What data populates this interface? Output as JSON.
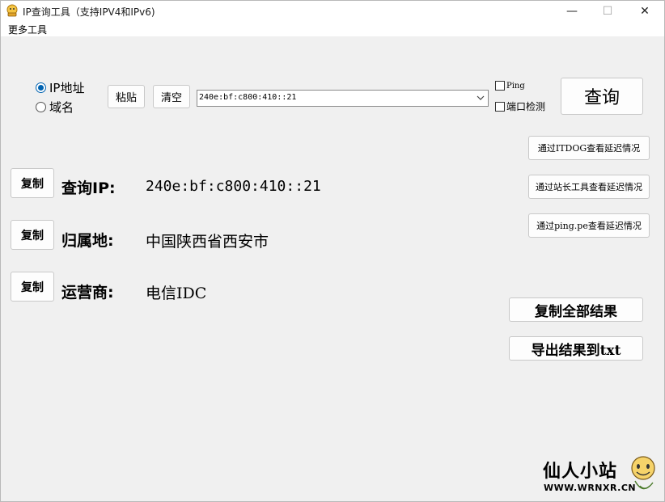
{
  "window": {
    "title": "IP查询工具（支持IPV4和IPv6)",
    "controls": {
      "minimize": "—",
      "maximize": "☐",
      "close": "✕"
    }
  },
  "menu": {
    "more_tools": "更多工具"
  },
  "query": {
    "mode_options": [
      {
        "label": "IP地址",
        "selected": true
      },
      {
        "label": "域名",
        "selected": false
      }
    ],
    "paste_label": "粘贴",
    "clear_label": "清空",
    "input_value": "240e:bf:c800:410::21",
    "ping_label": "Ping",
    "ping_checked": false,
    "port_check_label": "端口检测",
    "port_check_checked": false,
    "submit_label": "查询"
  },
  "latency_buttons": [
    "通过ITDOG查看延迟情况",
    "通过站长工具查看延迟情况",
    "通过ping.pe查看延迟情况"
  ],
  "results": [
    {
      "copy_label": "复制",
      "label": "查询IP:",
      "value": "240e:bf:c800:410::21"
    },
    {
      "copy_label": "复制",
      "label": "归属地:",
      "value": "中国陕西省西安市"
    },
    {
      "copy_label": "复制",
      "label": "运营商:",
      "value": "电信IDC"
    }
  ],
  "actions": {
    "copy_all": "复制全部结果",
    "export_txt": "导出结果到txt"
  },
  "watermark": {
    "main": "仙人小站",
    "sub": "WWW.WRNXR.CN"
  },
  "colors": {
    "window_bg": "#f0f0f0",
    "accent": "#0063b1"
  }
}
